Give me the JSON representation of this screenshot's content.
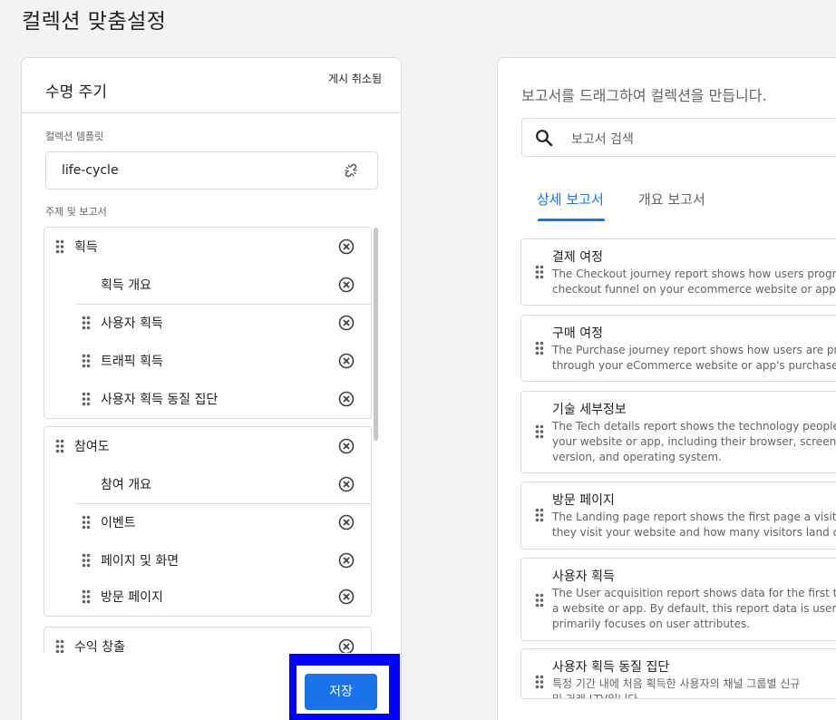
{
  "page": {
    "title": "컬렉션 맞춤설정"
  },
  "collection": {
    "name": "수명 주기",
    "status": "게시 취소됨",
    "template_label": "컬렉션 템플릿",
    "template_value": "life-cycle",
    "topics_label": "주제 및 보고서",
    "topics": [
      {
        "name": "획득",
        "overview": "획득 개요",
        "reports": [
          "사용자 획득",
          "트래픽 획득",
          "사용자 획득 동질 집단"
        ]
      },
      {
        "name": "참여도",
        "overview": "참여 개요",
        "reports": [
          "이벤트",
          "페이지 및 화면",
          "방문 페이지"
        ]
      },
      {
        "name": "수익 창출"
      }
    ],
    "save_label": "저장"
  },
  "library": {
    "title": "보고서를 드래그하여 컬렉션을 만듭니다.",
    "search_placeholder": "보고서 검색",
    "tabs": [
      "상세 보고서",
      "개요 보고서"
    ],
    "active_tab": "상세 보고서",
    "reports": [
      {
        "title": "결제 여정",
        "description": "The Checkout journey report shows how users progre\ncheckout funnel on your ecommerce website or app."
      },
      {
        "title": "구매 여정",
        "description": "The Purchase journey report shows how users are pro\nthrough your eCommerce website or app's purchase f"
      },
      {
        "title": "기술 세부정보",
        "description": "The Tech details report shows the technology people\nyour website or app, including their browser, screen re\nversion, and operating system."
      },
      {
        "title": "방문 페이지",
        "description": "The Landing page report shows the first page a visito\nthey visit your website and how many visitors land on"
      },
      {
        "title": "사용자 획득",
        "description": "The User acquisition report shows data for the first tir\na website or app. By default, this report data is user-s\nprimarily focuses on user attributes."
      },
      {
        "title": "사용자 획득 동질 집단",
        "description": "특정 기간 내에 처음 획득한 사용자의 채널 그룹별 신규\n및 거래 LTV입니다"
      }
    ]
  },
  "colors": {
    "accent": "#1a73e8",
    "highlight": "#0000ff",
    "border": "#dadce0",
    "background": "#f1f3f4"
  }
}
